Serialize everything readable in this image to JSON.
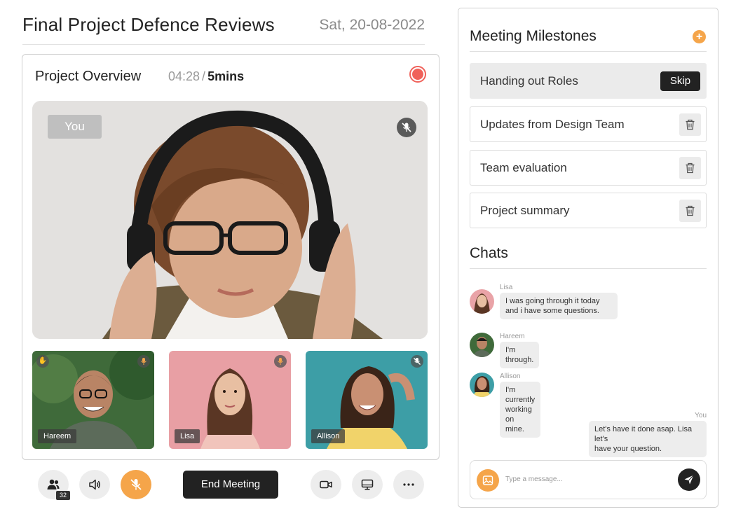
{
  "header": {
    "title": "Final Project Defence Reviews",
    "date": "Sat, 20-08-2022"
  },
  "overview": {
    "title": "Project Overview",
    "elapsed": "04:28",
    "separator": "/",
    "duration": "5mins",
    "main_label": "You"
  },
  "participants": [
    {
      "name": "Hareem"
    },
    {
      "name": "Lisa"
    },
    {
      "name": "Allison"
    }
  ],
  "controls": {
    "participant_count": "32",
    "end_label": "End Meeting"
  },
  "milestones": {
    "title": "Meeting Milestones",
    "add_label": "+",
    "items": [
      {
        "label": "Handing out Roles",
        "action": "Skip"
      },
      {
        "label": "Updates from Design Team"
      },
      {
        "label": "Team evaluation"
      },
      {
        "label": "Project summary"
      }
    ]
  },
  "chats": {
    "title": "Chats",
    "messages": [
      {
        "sender": "Lisa",
        "line1": "I was  going through it today",
        "line2": "and i have some questions."
      },
      {
        "sender": "Hareem",
        "line1": "I'm through."
      },
      {
        "sender": "Allison",
        "line1": "I'm currently working on mine."
      },
      {
        "sender": "You",
        "line1": "Let's have it done asap. Lisa let's",
        "line2": "have your question."
      }
    ],
    "input_placeholder": "Type a message..."
  },
  "colors": {
    "accent": "#f5a54a",
    "record": "#f0615a",
    "dark": "#222222"
  },
  "icons": [
    "record-icon",
    "mic-off-icon",
    "raise-hand-icon",
    "mic-icon",
    "participants-icon",
    "speaker-icon",
    "video-icon",
    "screen-share-icon",
    "more-icon",
    "plus-icon",
    "trash-icon",
    "image-icon",
    "send-icon"
  ]
}
